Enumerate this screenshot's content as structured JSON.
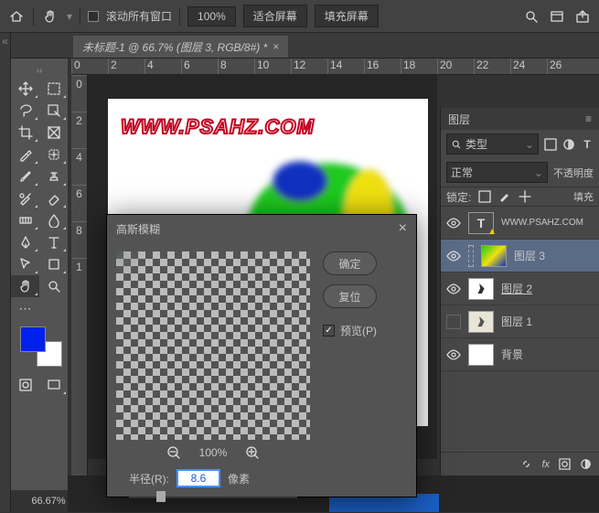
{
  "topbar": {
    "scroll_all": "滚动所有窗口",
    "zoom": "100%",
    "fit": "适合屏幕",
    "fill": "填充屏幕"
  },
  "doc": {
    "tab": "未标题-1 @ 66.7% (图层 3, RGB/8#) *",
    "zoom": "66.67%"
  },
  "ruler_h": [
    "0",
    "2",
    "4",
    "6",
    "8",
    "10",
    "12",
    "14",
    "16",
    "18",
    "20",
    "22",
    "24",
    "26"
  ],
  "ruler_v": [
    "0",
    "2",
    "4",
    "6",
    "8",
    "1"
  ],
  "watermark": "WWW.PSAHZ.COM",
  "dialog": {
    "title": "高斯模糊",
    "ok": "确定",
    "reset": "复位",
    "preview": "预览(P)",
    "zoom": "100%",
    "radius_label": "半径(R):",
    "radius_value": "8.6",
    "radius_unit": "像素"
  },
  "layers": {
    "tab": "图层",
    "kind": "类型",
    "blend": "正常",
    "opacity": "不透明度",
    "lock": "锁定:",
    "fill": "填充",
    "items": [
      {
        "name": "WWW.PSAHZ.COM"
      },
      {
        "name": "图层 3"
      },
      {
        "name": "图层 2"
      },
      {
        "name": "图层 1"
      },
      {
        "name": "背景"
      }
    ]
  },
  "chart_data": {
    "type": "blur-preview",
    "radius_px": 8.6
  }
}
